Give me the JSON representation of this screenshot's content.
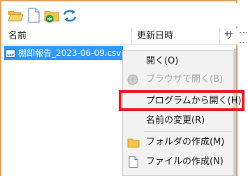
{
  "toolbar": {
    "buttons": [
      {
        "icon": "open-folder-icon"
      },
      {
        "icon": "new-file-icon"
      },
      {
        "icon": "new-folder-icon"
      },
      {
        "icon": "refresh-icon"
      }
    ]
  },
  "columns": {
    "name": "名前",
    "modified": "更新日時",
    "size": "サ"
  },
  "file": {
    "name": "棚卸報告_2023-06-09.csv",
    "icon": "csv-file-icon",
    "selected": true
  },
  "context_menu": {
    "items": [
      {
        "label": "開く(O)",
        "enabled": true
      },
      {
        "label": "ブラウザで開く(B)",
        "enabled": false,
        "icon": "browser-icon"
      },
      {
        "label": "プログラムから開く(H)",
        "enabled": true,
        "highlighted": true
      },
      {
        "label": "名前の変更(R)",
        "enabled": true
      },
      {
        "label": "フォルダの作成(M)",
        "enabled": true,
        "icon": "folder-icon"
      },
      {
        "label": "ファイルの作成(N)",
        "enabled": true,
        "icon": "file-icon"
      }
    ]
  },
  "colors": {
    "frame_border": "#e0a05a",
    "selection": "#3399ff",
    "highlight_box": "#e61e2a",
    "menu_bg": "#f2f2f2"
  }
}
